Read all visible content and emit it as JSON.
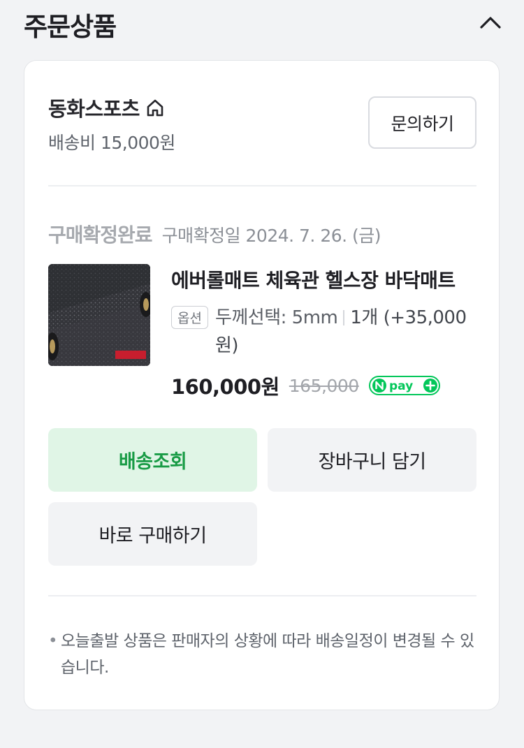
{
  "section": {
    "title": "주문상품",
    "collapse_icon": "chevron-up-icon"
  },
  "store": {
    "name": "동화스포츠",
    "home_icon": "home-icon",
    "shipping_fee": "배송비 15,000원",
    "inquiry_label": "문의하기"
  },
  "order": {
    "status": "구매확정완료",
    "date": "구매확정일 2024. 7. 26. (금)"
  },
  "product": {
    "name": "에버롤매트 체육관 헬스장 바닥매트",
    "option_badge": "옵션",
    "option": "두께선택: 5mm",
    "quantity": "1개 (+35,000원)",
    "price": "160,000원",
    "original_price": "165,000",
    "npay_label": "pay"
  },
  "buttons": {
    "track": "배송조회",
    "cart": "장바구니 담기",
    "buy_now": "바로 구매하기"
  },
  "notice": {
    "text": "오늘출발 상품은 판매자의 상황에 따라 배송일정이 변경될 수 있습니다."
  },
  "colors": {
    "accent_green": "#189b45",
    "track_bg": "#e0f5e6",
    "npay_green": "#03c75a"
  }
}
